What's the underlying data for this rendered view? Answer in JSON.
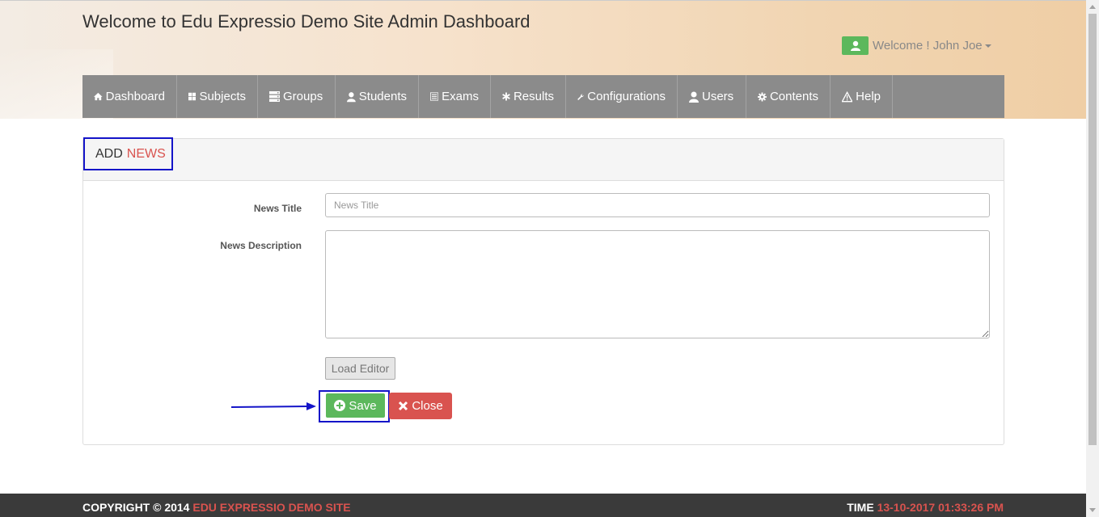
{
  "header": {
    "title": "Welcome to Edu Expressio Demo Site Admin Dashboard",
    "user_greeting": "Welcome ! John Joe"
  },
  "nav": {
    "items": [
      {
        "label": "Dashboard",
        "icon": "home-icon"
      },
      {
        "label": "Subjects",
        "icon": "grid-icon"
      },
      {
        "label": "Groups",
        "icon": "server-icon"
      },
      {
        "label": "Students",
        "icon": "user-icon"
      },
      {
        "label": "Exams",
        "icon": "list-icon"
      },
      {
        "label": "Results",
        "icon": "asterisk-icon"
      },
      {
        "label": "Configurations",
        "icon": "wrench-icon"
      },
      {
        "label": "Users",
        "icon": "user-icon"
      },
      {
        "label": "Contents",
        "icon": "cog-icon"
      },
      {
        "label": "Help",
        "icon": "warning-icon"
      }
    ]
  },
  "panel": {
    "title_prefix": "ADD",
    "title_highlight": "NEWS"
  },
  "form": {
    "news_title_label": "News Title",
    "news_title_placeholder": "News Title",
    "news_description_label": "News Description",
    "load_editor_label": "Load Editor",
    "save_label": "Save",
    "close_label": "Close"
  },
  "footer": {
    "copyright_prefix": "COPYRIGHT © 2014",
    "site_name": "EDU EXPRESSIO DEMO SITE",
    "time_label": "TIME",
    "time_value": "13-10-2017 01:33:26 PM"
  },
  "colors": {
    "nav_bg": "#8b8b8b",
    "accent_red": "#d9534f",
    "accent_green": "#5cb85c",
    "annotation_blue": "#1414c8"
  }
}
